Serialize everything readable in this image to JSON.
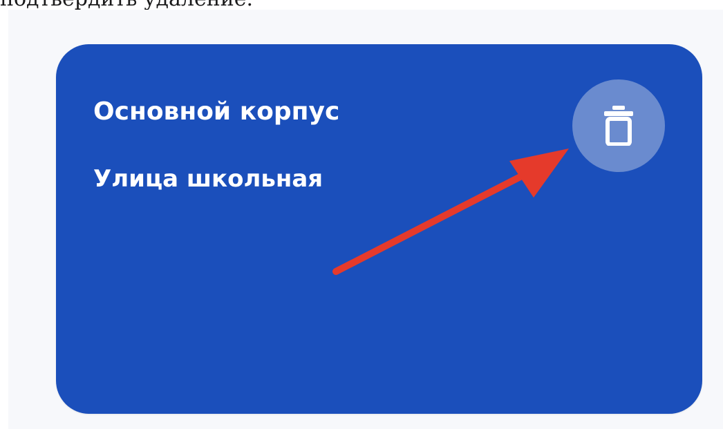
{
  "document": {
    "text_line": "подтвердить удаление."
  },
  "card": {
    "title": "Основной корпус",
    "address": "Улица школьная",
    "background_color": "#1b4fbb",
    "delete_button": {
      "icon": "trash-icon",
      "color": "#6a8bcf"
    }
  },
  "annotation": {
    "type": "arrow",
    "color": "#e53a2b",
    "points_to": "delete-button"
  }
}
